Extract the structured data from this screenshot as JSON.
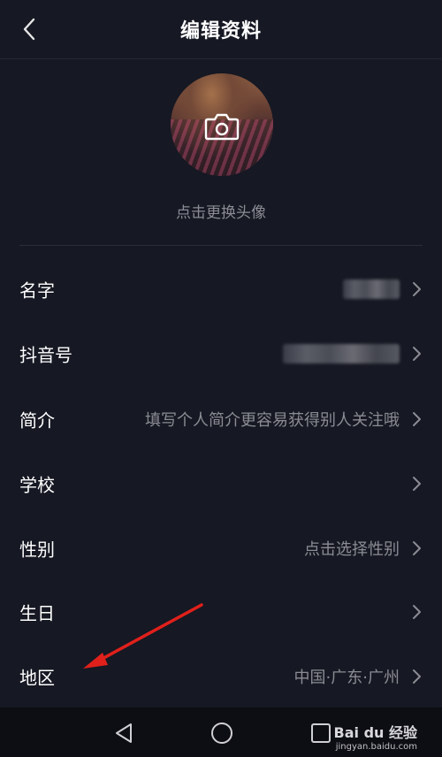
{
  "header": {
    "title": "编辑资料"
  },
  "avatar": {
    "hint": "点击更换头像"
  },
  "rows": [
    {
      "label": "名字",
      "value": "",
      "blurred": true
    },
    {
      "label": "抖音号",
      "value": "",
      "blurred": true
    },
    {
      "label": "简介",
      "value": "填写个人简介更容易获得别人关注哦"
    },
    {
      "label": "学校",
      "value": ""
    },
    {
      "label": "性别",
      "value": "点击选择性别"
    },
    {
      "label": "生日",
      "value": ""
    },
    {
      "label": "地区",
      "value": "中国·广东·广州"
    }
  ],
  "watermark": {
    "brand": "Bai du 经验",
    "url": "jingyan.baidu.com"
  },
  "colors": {
    "background": "#161823",
    "text": "#ffffff",
    "muted": "#8b8c93",
    "arrow": "#e0201b"
  },
  "icons": [
    "back-arrow-icon",
    "camera-icon",
    "chevron-right-icon",
    "nav-back-icon",
    "nav-home-icon",
    "nav-recent-icon"
  ]
}
